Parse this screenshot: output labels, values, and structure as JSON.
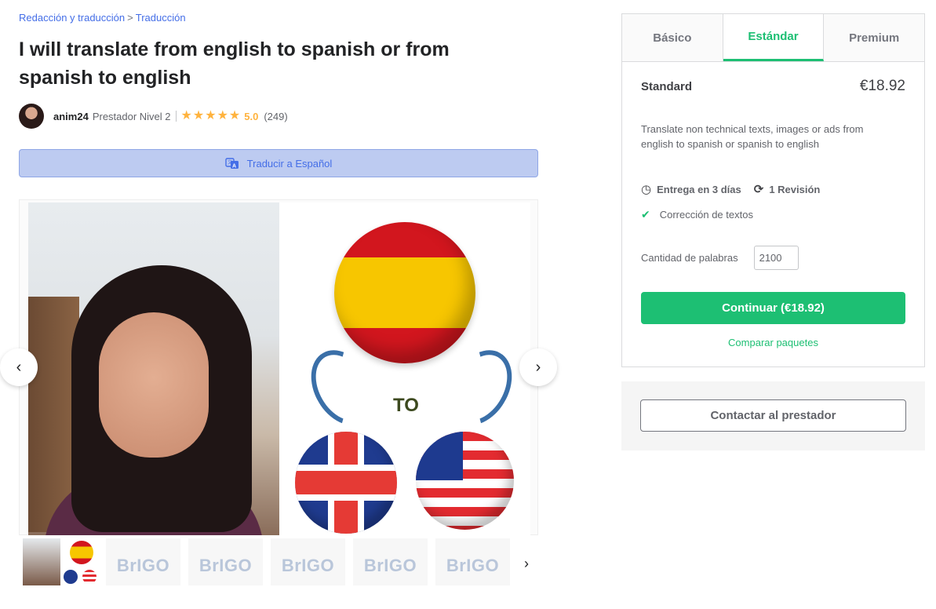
{
  "breadcrumb": {
    "category": "Redacción y traducción",
    "separator": ">",
    "subcategory": "Traducción"
  },
  "gig": {
    "title": "I will translate from english to spanish or from spanish to english"
  },
  "seller": {
    "username": "anim24",
    "level": "Prestador Nivel 2",
    "rating": "5.0",
    "reviews": "(249)",
    "stars": 5
  },
  "translate_bar": {
    "label": "Traducir a Español"
  },
  "gallery": {
    "image_text": "TO",
    "thumb_logo": "BrIGO"
  },
  "packages": {
    "tabs": [
      "Básico",
      "Estándar",
      "Premium"
    ],
    "active_tab": "Estándar",
    "selected": {
      "name": "Standard",
      "price": "€18.92",
      "description": "Translate non technical texts, images or ads from english to spanish or spanish to english",
      "delivery": "Entrega en 3 días",
      "revisions": "1 Revisión",
      "feature": "Corrección de textos",
      "quantity_label": "Cantidad de palabras",
      "quantity_value": "2100"
    },
    "continue_label": "Continuar (€18.92)",
    "compare_label": "Comparar paquetes"
  },
  "contact": {
    "label": "Contactar al prestador"
  },
  "colors": {
    "accent": "#1dbf73",
    "link": "#446ee7",
    "star": "#ffb33e"
  }
}
